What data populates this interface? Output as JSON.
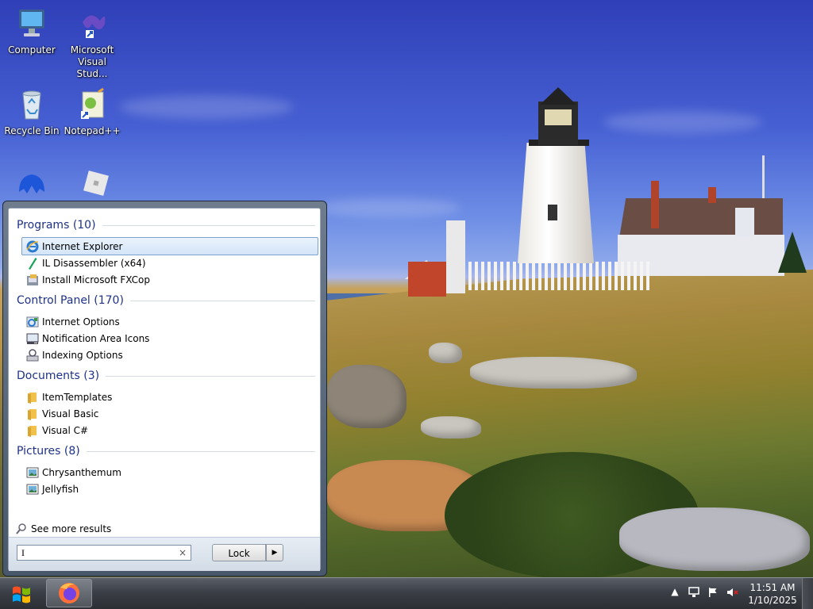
{
  "desktop": {
    "icons": [
      {
        "label": "Computer",
        "icon": "computer-icon"
      },
      {
        "label": "Microsoft Visual Stud...",
        "icon": "visual-studio-icon"
      },
      {
        "label": "Recycle Bin",
        "icon": "recycle-bin-icon"
      },
      {
        "label": "Notepad++",
        "icon": "notepad-plus-plus-icon"
      },
      {
        "label": "",
        "icon": "malwarebytes-icon"
      },
      {
        "label": "",
        "icon": "roblox-icon"
      }
    ]
  },
  "start_menu": {
    "groups": [
      {
        "title": "Programs (10)",
        "items": [
          {
            "label": "Internet Explorer",
            "icon": "internet-explorer-icon",
            "selected": true
          },
          {
            "label": "IL Disassembler (x64)",
            "icon": "il-disassembler-icon"
          },
          {
            "label": "Install Microsoft FXCop",
            "icon": "installer-icon"
          }
        ]
      },
      {
        "title": "Control Panel (170)",
        "items": [
          {
            "label": "Internet Options",
            "icon": "internet-options-icon"
          },
          {
            "label": "Notification Area Icons",
            "icon": "notification-area-icon"
          },
          {
            "label": "Indexing Options",
            "icon": "indexing-options-icon"
          }
        ]
      },
      {
        "title": "Documents (3)",
        "items": [
          {
            "label": "ItemTemplates",
            "icon": "folder-icon"
          },
          {
            "label": "Visual Basic",
            "icon": "folder-icon"
          },
          {
            "label": "Visual C#",
            "icon": "folder-icon"
          }
        ]
      },
      {
        "title": "Pictures (8)",
        "items": [
          {
            "label": "Chrysanthemum",
            "icon": "image-icon"
          },
          {
            "label": "Jellyfish",
            "icon": "image-icon"
          }
        ]
      }
    ],
    "see_more": "See more results",
    "search_value": "I",
    "search_clear": "×",
    "lock_label": "Lock",
    "lock_arrow": "▶"
  },
  "taskbar": {
    "pinned": [
      {
        "name": "Firefox",
        "icon": "firefox-icon"
      }
    ],
    "tray": {
      "show_hidden": "▲",
      "time": "11:51 AM",
      "date": "1/10/2025"
    }
  },
  "colors": {
    "group_title": "#1e3287",
    "selection_border": "#7da2ce",
    "taskbar": "#2b2e33"
  }
}
